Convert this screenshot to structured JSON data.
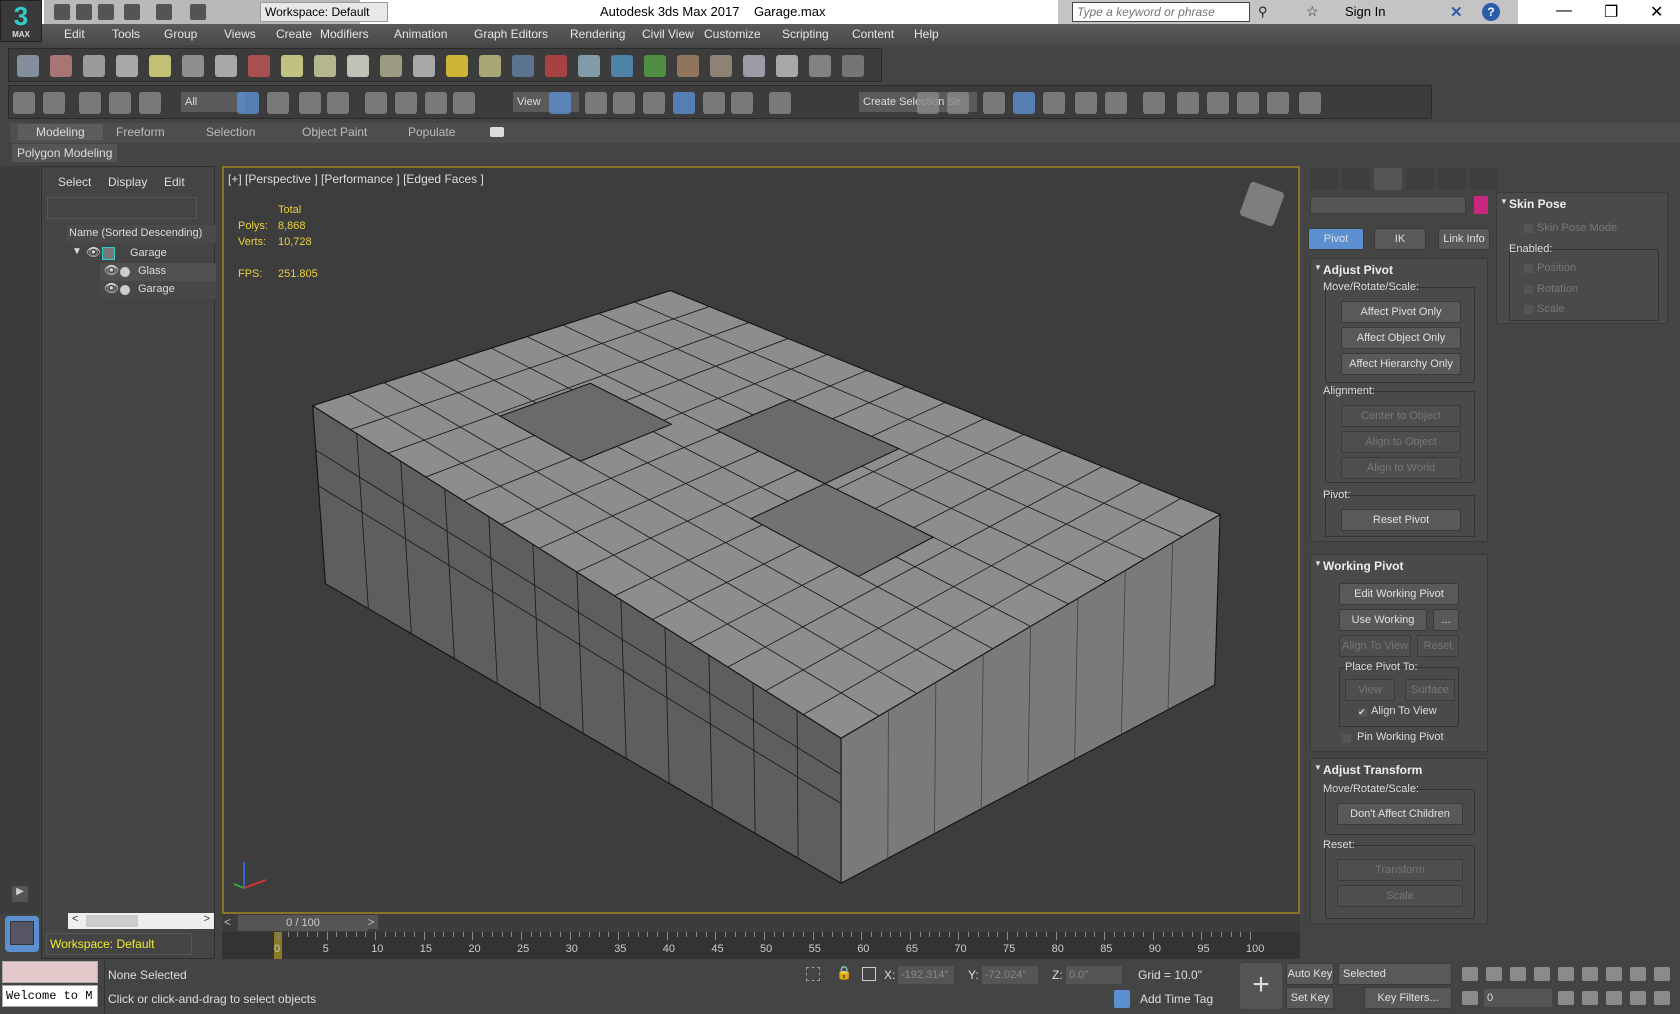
{
  "app": {
    "logo": "3",
    "logo_sub": "MAX",
    "title": "Autodesk 3ds Max 2017",
    "file": "Garage.max",
    "workspace": "Workspace: Default",
    "search_placeholder": "Type a keyword or phrase",
    "sign_in": "Sign In"
  },
  "menu": [
    "Edit",
    "Tools",
    "Group",
    "Views",
    "Create",
    "Modifiers",
    "Animation",
    "Graph Editors",
    "Rendering",
    "Civil View",
    "Customize",
    "Scripting",
    "Content",
    "Help"
  ],
  "toolbar1_icons": [
    "teapot-icon",
    "render-frame-icon",
    "scene-explorer-icon",
    "layer-explorer-icon",
    "light-lister-icon",
    "camera-icon",
    "material-icon",
    "render-icon",
    "plane-icon",
    "dome-icon",
    "sphere-light-icon",
    "teapot-mesh-icon",
    "cone-icon",
    "sun-icon",
    "sky-icon",
    "particle-icon",
    "atom-icon",
    "pylon-icon",
    "gear-shape-icon",
    "grass-icon",
    "hair-icon",
    "ox-icon",
    "shade-sphere-icon",
    "material-grid-icon",
    "script-icon",
    "help-icon"
  ],
  "toolbar2": {
    "filter": "All",
    "ref_coord": "View",
    "named_sel": "Create Selection Se"
  },
  "toolbar2_icons": [
    "undo-icon",
    "redo-icon",
    "link-icon",
    "unlink-icon",
    "bind-spacewarp-icon",
    "select-object-icon",
    "select-by-name-icon",
    "rect-region-icon",
    "window-crossing-icon",
    "move-icon",
    "rotate-icon",
    "scale-icon",
    "place-icon",
    "pivot-icon",
    "manipulate-icon",
    "keyboard-shortcut-icon",
    "snap-3d-icon",
    "angle-snap-icon",
    "percent-snap-icon",
    "spinner-snap-icon",
    "edit-named-sel-icon",
    "mirror-icon",
    "align-icon",
    "layer-toggle-icon",
    "ribbon-icon",
    "scene-explorer-icon",
    "curve-editor-icon",
    "schematic-icon",
    "material-editor-icon",
    "render-setup-icon",
    "rendered-frame-icon",
    "render-production-icon",
    "render-cloud-icon",
    "viewport-layout-icon"
  ],
  "ribbon": {
    "tabs": [
      "Modeling",
      "Freeform",
      "Selection",
      "Object Paint",
      "Populate"
    ],
    "active": "Modeling",
    "panel": "Polygon Modeling"
  },
  "explorer": {
    "tabs": [
      "Select",
      "Display",
      "Edit"
    ],
    "column": "Name (Sorted Descending)",
    "items": [
      {
        "name": "Garage",
        "level": 0
      },
      {
        "name": "Glass",
        "level": 1
      },
      {
        "name": "Garage",
        "level": 1
      }
    ],
    "workspace": "Workspace: Default"
  },
  "viewport": {
    "label": "[+] [Perspective ] [Performance ] [Edged Faces ]",
    "total": "Total",
    "polys_label": "Polys:",
    "polys": "8,868",
    "verts_label": "Verts:",
    "verts": "10,728",
    "fps_label": "FPS:",
    "fps": "251.805"
  },
  "cmd": {
    "tabs": [
      "create-icon",
      "modify-icon",
      "hierarchy-icon",
      "motion-icon",
      "display-icon",
      "utilities-icon"
    ],
    "color": "#c8287f",
    "subtabs": [
      "Pivot",
      "IK",
      "Link Info"
    ],
    "adjust_pivot": {
      "title": "Adjust Pivot",
      "mrs": "Move/Rotate/Scale:",
      "b1": "Affect Pivot Only",
      "b2": "Affect Object Only",
      "b3": "Affect Hierarchy Only",
      "alignment": "Alignment:",
      "a1": "Center to Object",
      "a2": "Align to Object",
      "a3": "Align to World",
      "pivot": "Pivot:",
      "reset": "Reset Pivot"
    },
    "working_pivot": {
      "title": "Working Pivot",
      "edit": "Edit Working Pivot",
      "use": "Use Working Pivot",
      "more": "...",
      "align_view": "Align To View",
      "reset": "Reset",
      "place": "Place Pivot To:",
      "view": "View",
      "surface": "Surface",
      "align_cb": "Align To View",
      "pin": "Pin Working Pivot"
    },
    "adjust_transform": {
      "title": "Adjust Transform",
      "mrs": "Move/Rotate/Scale:",
      "dac": "Don't Affect Children",
      "reset": "Reset:",
      "transform": "Transform",
      "scale": "Scale"
    },
    "skin_pose": {
      "title": "Skin Pose",
      "mode": "Skin Pose Mode",
      "enabled": "Enabled:",
      "position": "Position",
      "rotation": "Rotation",
      "scale": "Scale"
    }
  },
  "timeline": {
    "frame": "0 / 100",
    "ticks": [
      "0",
      "5",
      "10",
      "15",
      "20",
      "25",
      "30",
      "35",
      "40",
      "45",
      "50",
      "55",
      "60",
      "65",
      "70",
      "75",
      "80",
      "85",
      "90",
      "95",
      "100"
    ]
  },
  "status": {
    "listener": "Welcome to M",
    "selection": "None Selected",
    "prompt": "Click or click-and-drag to select objects",
    "x_label": "X:",
    "x": "-192.314\"",
    "y_label": "Y:",
    "y": "-72.024\"",
    "z_label": "Z:",
    "z": "0.0\"",
    "grid": "Grid = 10.0\"",
    "add_time_tag": "Add Time Tag",
    "auto_key": "Auto Key",
    "set_key": "Set Key",
    "key_mode": "Selected",
    "key_filters": "Key Filters...",
    "current_frame": "0"
  }
}
